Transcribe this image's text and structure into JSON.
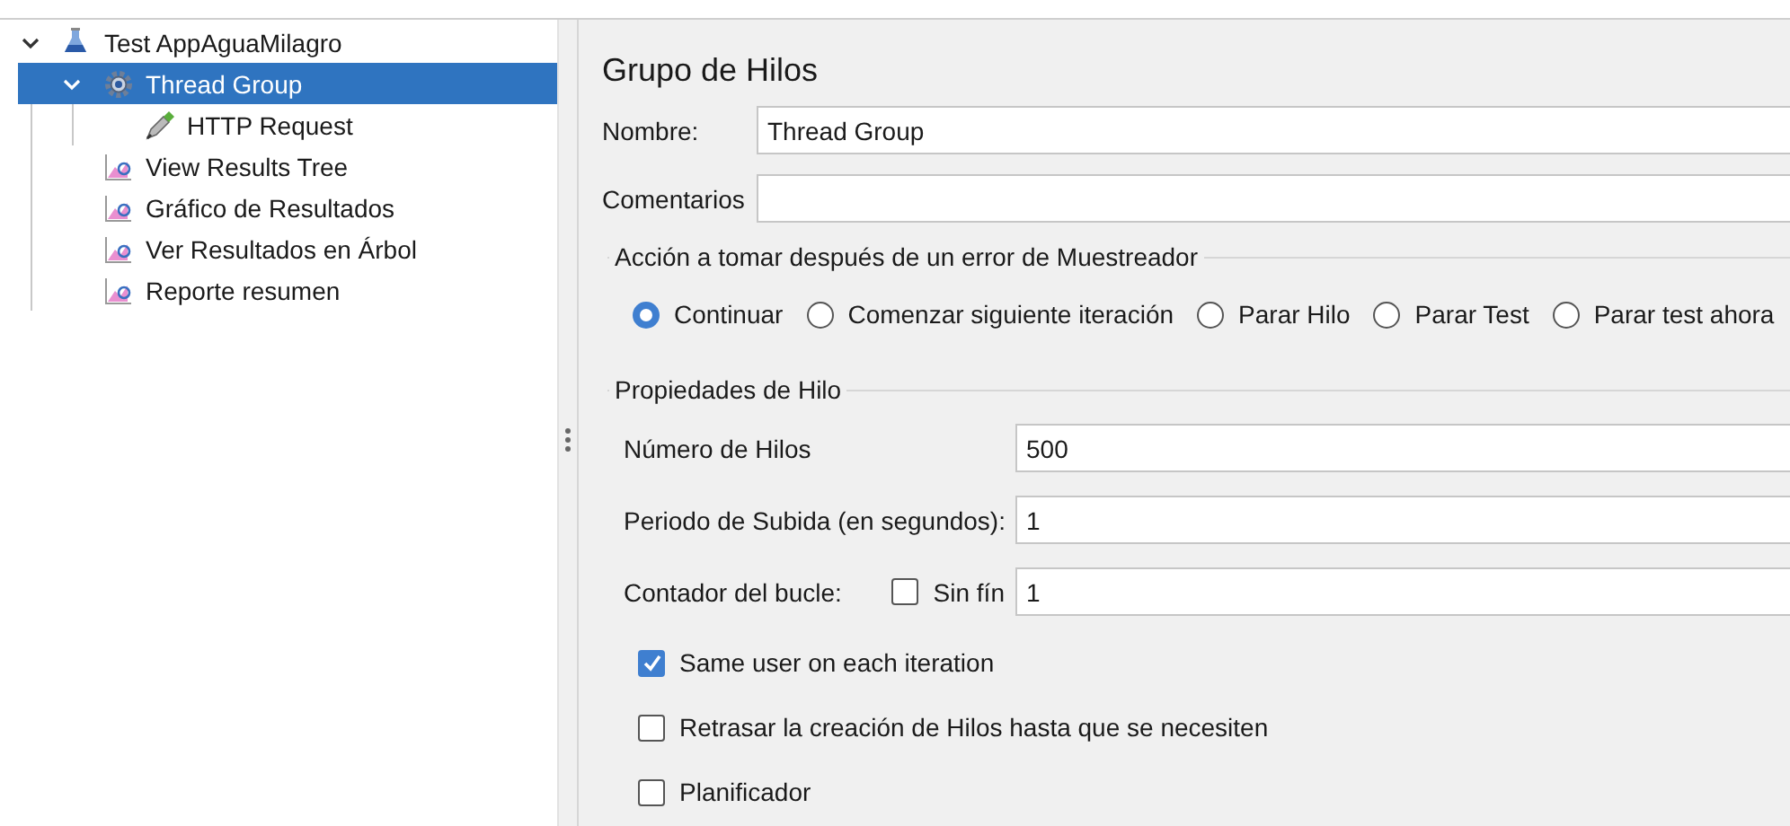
{
  "tree": [
    {
      "label": "Test AppAguaMilagro",
      "kind": "test-plan",
      "expanded": true,
      "selected": false,
      "children": [
        {
          "label": "Thread Group",
          "kind": "thread-group",
          "expanded": true,
          "selected": true,
          "children": [
            {
              "label": "HTTP Request",
              "kind": "sampler",
              "selected": false
            }
          ]
        },
        {
          "label": "View Results Tree",
          "kind": "listener",
          "selected": false
        },
        {
          "label": "Gráfico de Resultados",
          "kind": "listener",
          "selected": false
        },
        {
          "label": "Ver Resultados en Árbol",
          "kind": "listener",
          "selected": false
        },
        {
          "label": "Reporte resumen",
          "kind": "listener",
          "selected": false
        }
      ]
    }
  ],
  "panel": {
    "title": "Grupo de Hilos",
    "fields": [
      {
        "label": "Nombre:",
        "value": "Thread Group"
      },
      {
        "label": "Comentarios"
      }
    ],
    "error_action": {
      "legend": "Acción a tomar después de un error de Muestreador",
      "options": [
        {
          "label": "Continuar",
          "selected": true
        },
        {
          "label": "Comenzar siguiente iteración",
          "selected": false
        },
        {
          "label": "Parar Hilo",
          "selected": false
        },
        {
          "label": "Parar Test",
          "selected": false
        },
        {
          "label": "Parar test ahora",
          "selected": false
        }
      ]
    },
    "thread_properties": {
      "legend": "Propiedades de Hilo",
      "fields": [
        {
          "label": "Número de Hilos",
          "value": "500"
        },
        {
          "label": "Periodo de Subida (en segundos):",
          "value": "1"
        },
        {
          "label": "Contador del bucle:",
          "value": "1",
          "infinite": {
            "label": "Sin fín",
            "checked": false
          }
        }
      ],
      "options": [
        {
          "label": "Same user on each iteration",
          "checked": true
        },
        {
          "label": "Retrasar la creación de Hilos hasta que se necesiten",
          "checked": false
        },
        {
          "label": "Planificador",
          "checked": false
        }
      ]
    }
  }
}
